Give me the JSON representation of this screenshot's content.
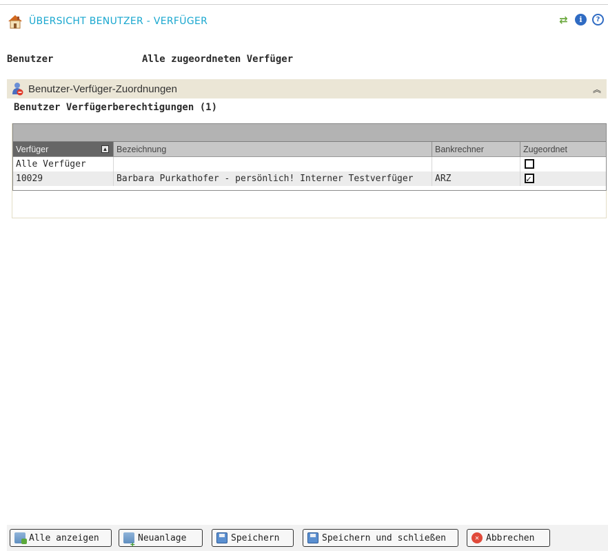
{
  "header": {
    "title": "ÜBERSICHT BENUTZER - VERFÜGER",
    "icons": [
      "house-icon",
      "refresh-icon",
      "info-icon",
      "help-icon"
    ]
  },
  "labels": {
    "benutzer": "Benutzer",
    "verfueger_scope": "Alle zugeordneten Verfüger"
  },
  "panel": {
    "title": "Benutzer-Verfüger-Zuordnungen",
    "subtitle": "Benutzer Verfügerberechtigungen (1)"
  },
  "grid": {
    "columns": [
      "Verfüger",
      "Bezeichnung",
      "Bankrechner",
      "Zugeordnet"
    ],
    "sorted_column": "Verfüger",
    "rows": [
      {
        "verfueger": "Alle Verfüger",
        "bezeichnung": "",
        "bankrechner": "",
        "zugeordnet": false
      },
      {
        "verfueger": "10029",
        "bezeichnung": "Barbara Purkathofer - persönlich! Interner Testverfüger",
        "bankrechner": "ARZ",
        "zugeordnet": true
      }
    ]
  },
  "buttons": {
    "show_all": "Alle anzeigen",
    "new": "Neuanlage",
    "save": "Speichern",
    "save_close": "Speichern und schließen",
    "cancel": "Abbrechen"
  },
  "colors": {
    "title": "#19a7cf",
    "panel_header": "#ebe6d6",
    "sorted_header": "#666666"
  }
}
